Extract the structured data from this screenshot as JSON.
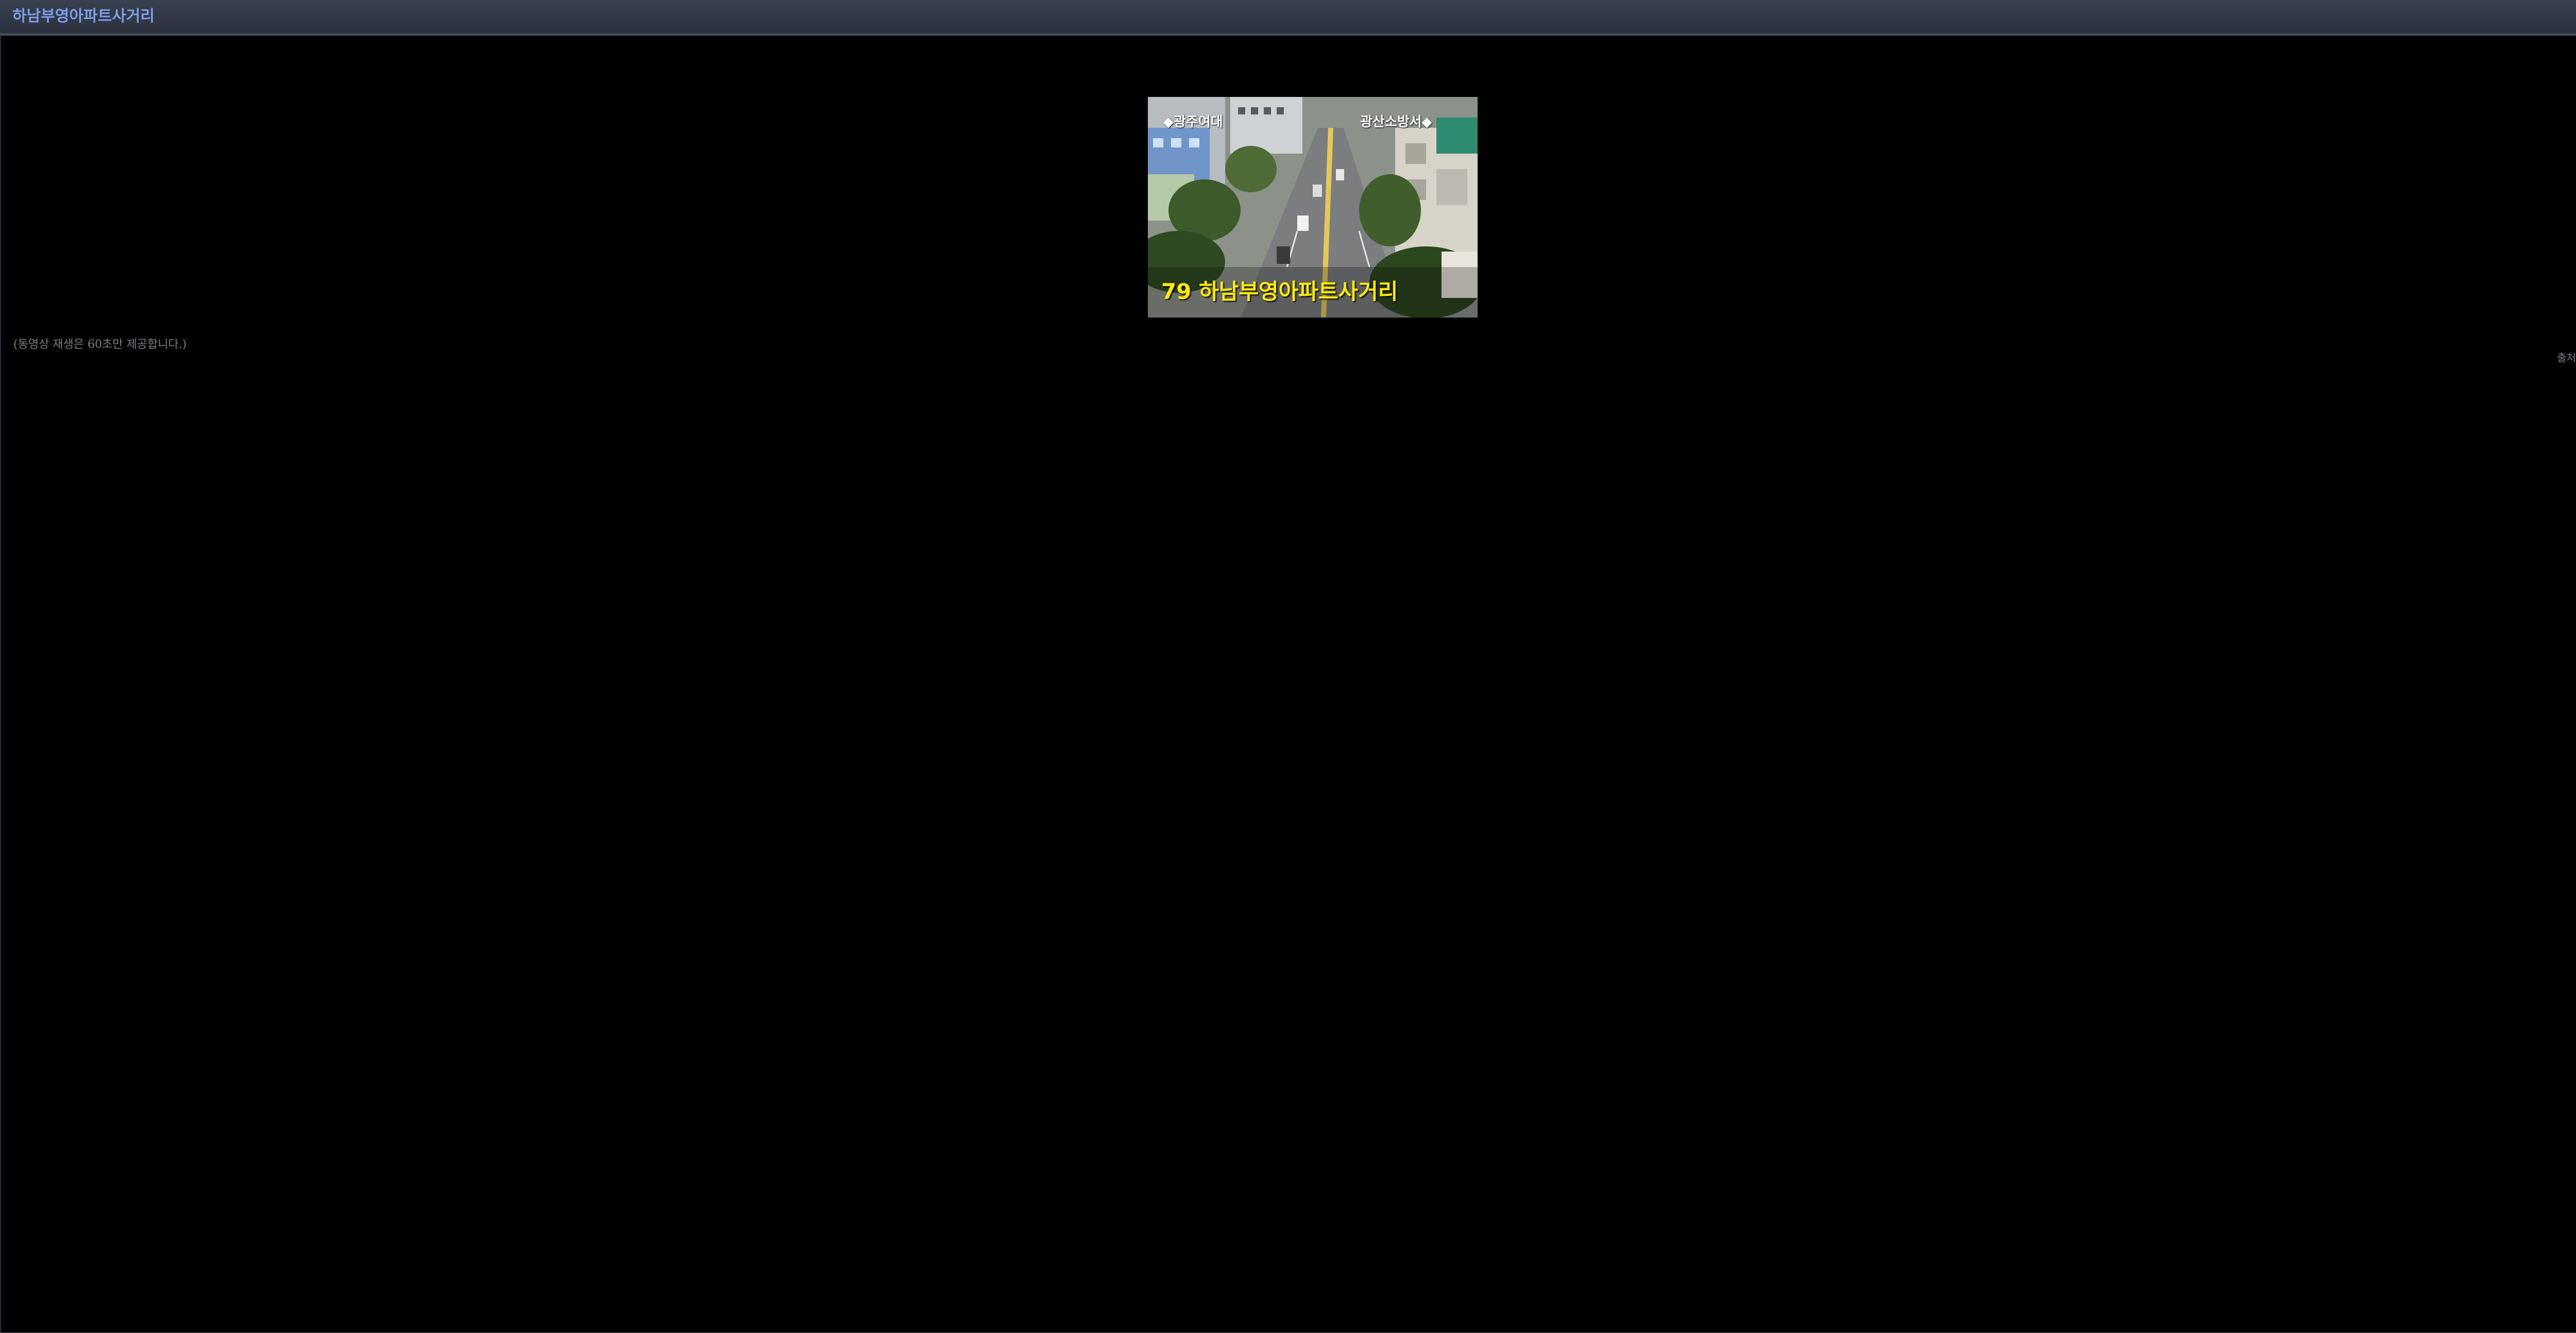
{
  "window": {
    "title": "하남부영아파트사거리",
    "close_icon": "close-icon"
  },
  "player": {
    "direction_left": "◆광주여대",
    "direction_right": "광산소방서◆",
    "caption": "79 하남부영아파트사거리"
  },
  "notice": {
    "text": "(동영상 재생은 60초만 제공합니다.)"
  },
  "footer": {
    "source": "출처:광주시"
  },
  "colors": {
    "title": "#7f9ee8",
    "titlebar": "#2f3542",
    "caption": "#ffeb00",
    "background": "#000000"
  }
}
